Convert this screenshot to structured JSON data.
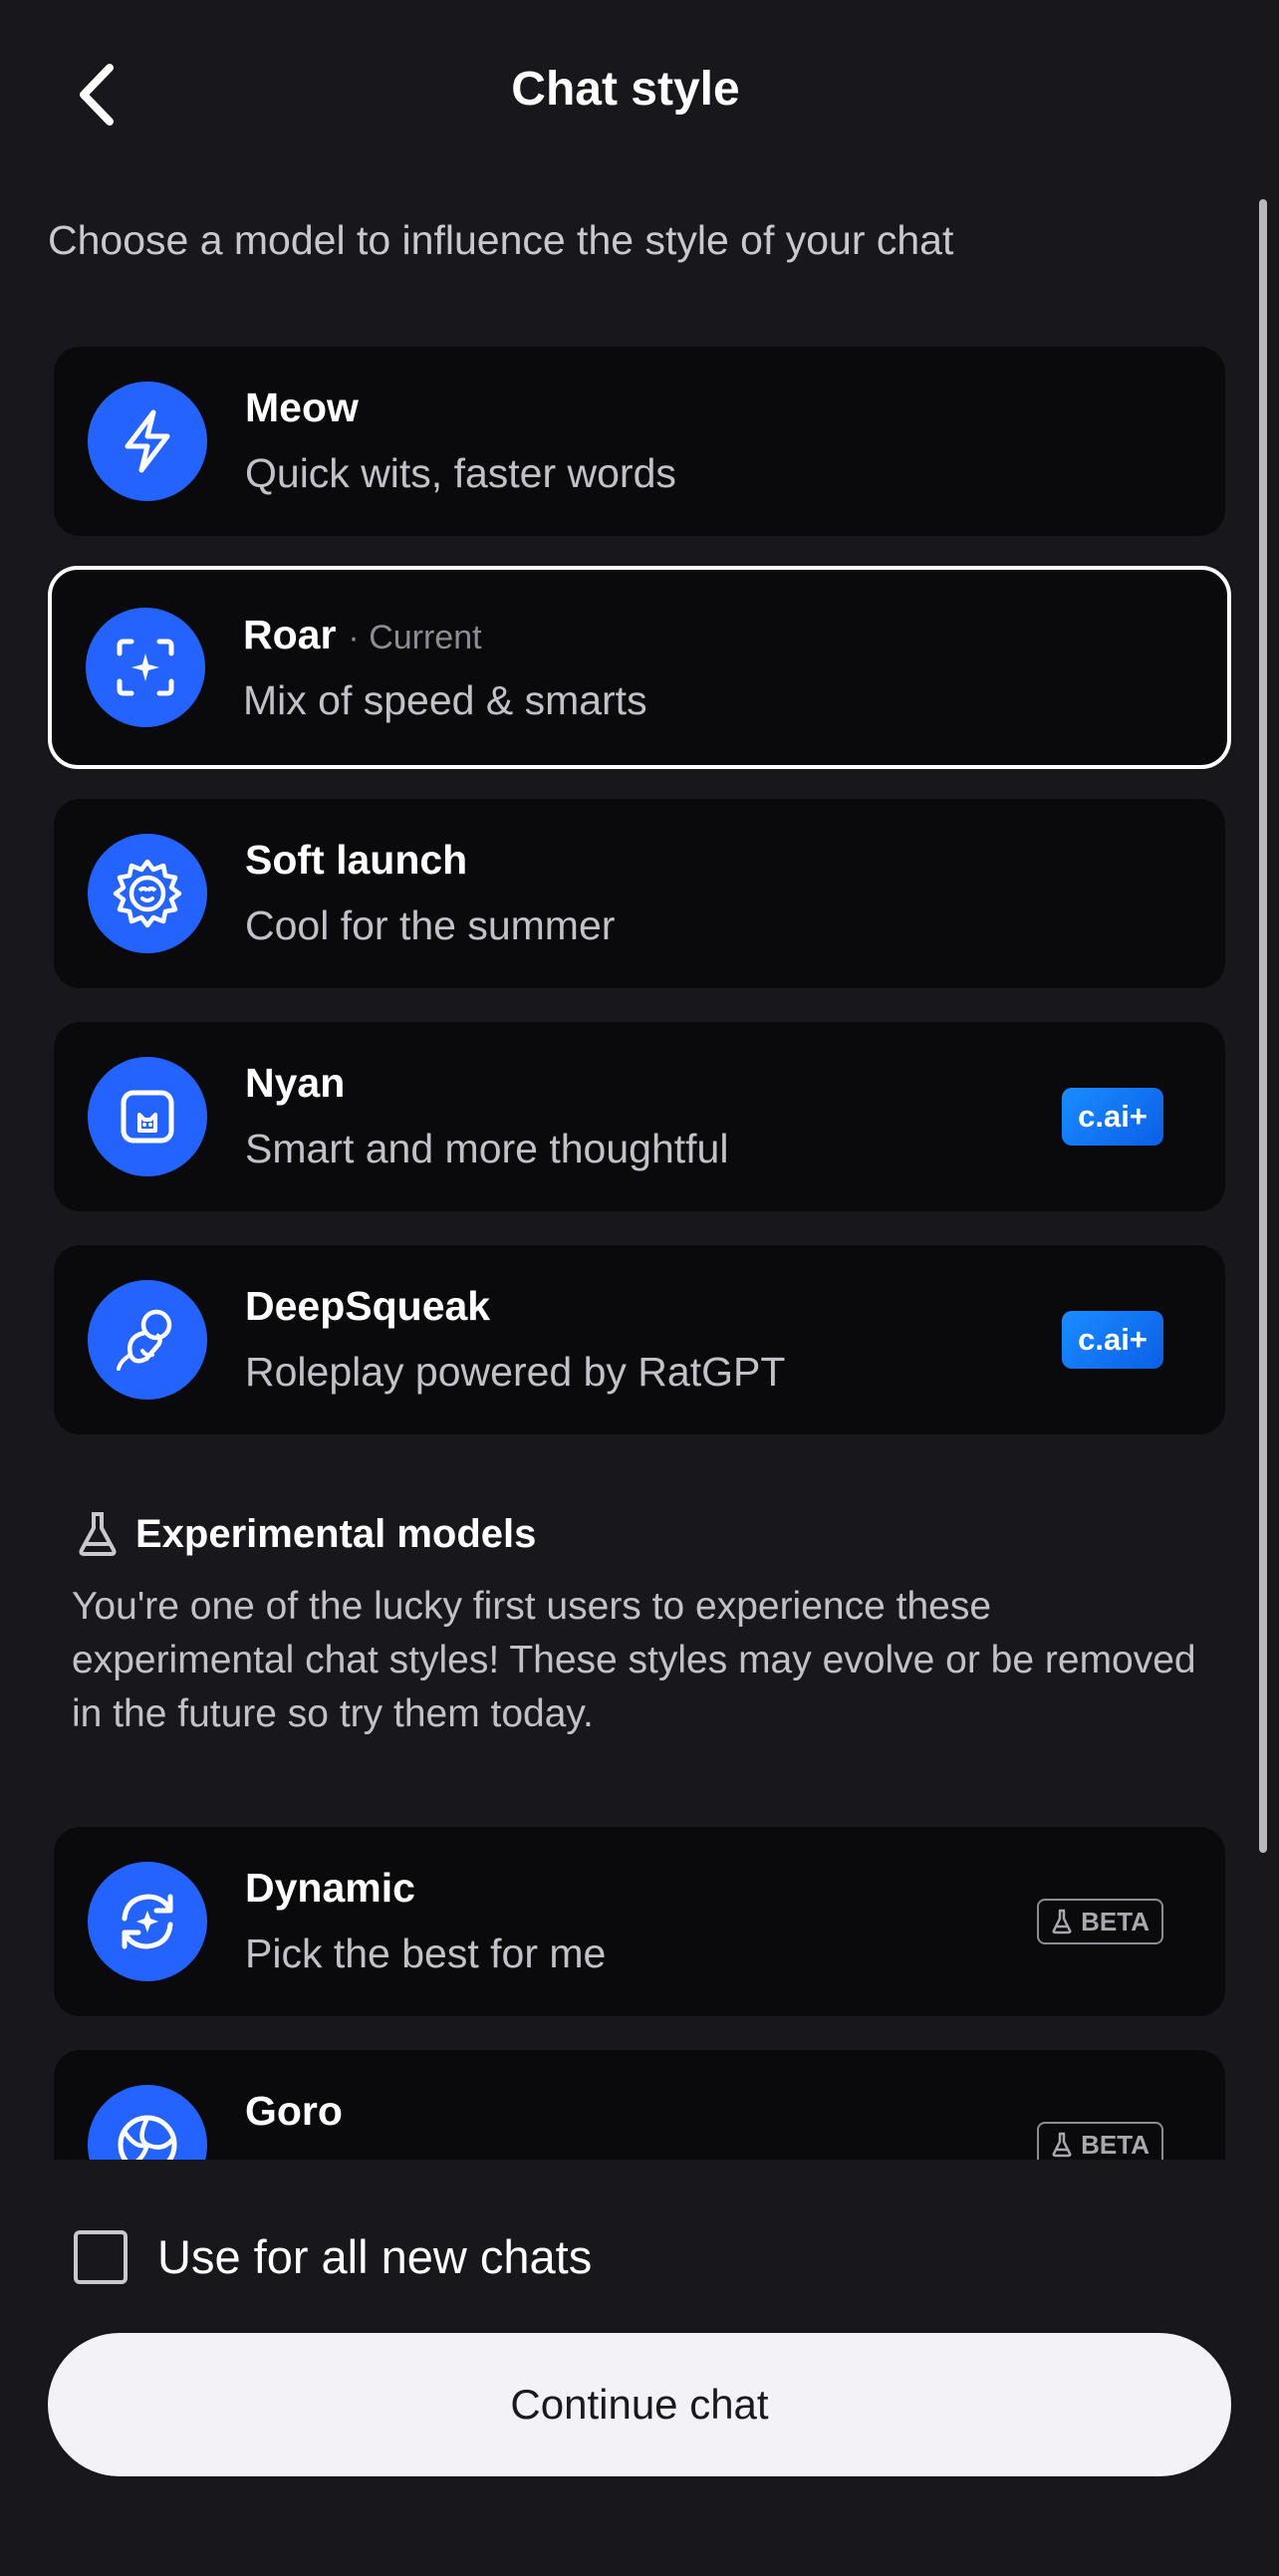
{
  "header": {
    "title": "Chat style",
    "back_icon": "chevron-left-icon"
  },
  "subtitle": "Choose a model to influence the style of your chat",
  "models": [
    {
      "name": "Meow",
      "description": "Quick wits, faster words",
      "icon": "lightning-icon"
    },
    {
      "name": "Roar",
      "status": "· Current",
      "description": "Mix of speed & smarts",
      "icon": "sparkle-frame-icon"
    },
    {
      "name": "Soft launch",
      "description": "Cool for the summer",
      "icon": "sunburst-face-icon"
    },
    {
      "name": "Nyan",
      "description": "Smart and more thoughtful",
      "icon": "cat-frame-icon",
      "badge": "c.ai+"
    },
    {
      "name": "DeepSqueak",
      "description": "Roleplay powered by RatGPT",
      "icon": "mouse-icon",
      "badge": "c.ai+"
    }
  ],
  "experimental": {
    "heading": "Experimental models",
    "icon": "flask-icon",
    "description": "You're one of the lucky first users to experience these experimental chat styles! These styles may evolve or be removed in the future so try them today.",
    "models": [
      {
        "name": "Dynamic",
        "description": "Pick the best for me",
        "icon": "refresh-sparkle-icon",
        "badge": "BETA"
      },
      {
        "name": "Goro",
        "description": "",
        "icon": "volleyball-icon",
        "badge": "BETA"
      }
    ]
  },
  "footer": {
    "checkbox_label": "Use for all new chats",
    "checkbox_checked": false,
    "continue_label": "Continue chat"
  },
  "colors": {
    "background": "#18171c",
    "card": "#0a0a0d",
    "accent": "#2563ff",
    "badge_plus": "#1b8cff"
  }
}
